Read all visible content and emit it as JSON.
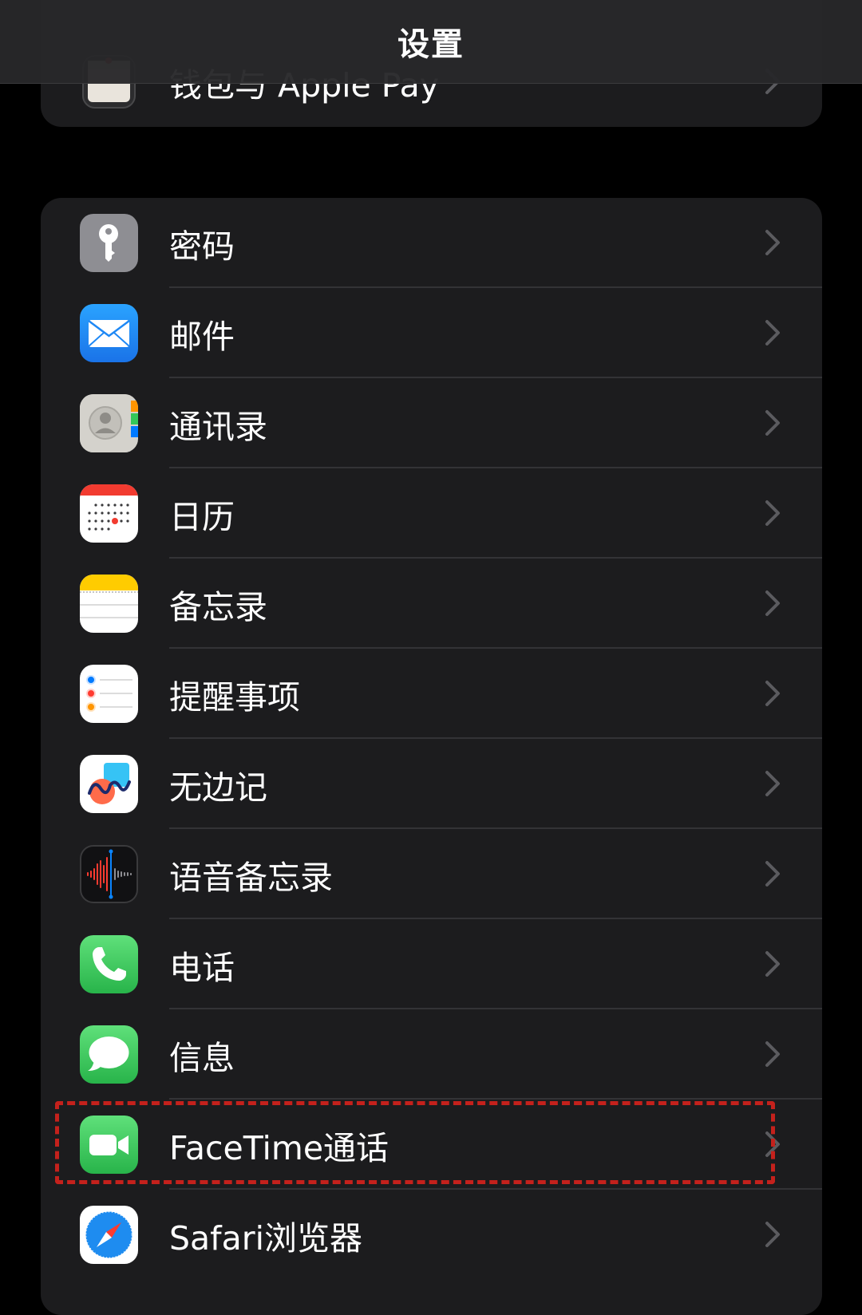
{
  "nav": {
    "title": "设置"
  },
  "top_group": {
    "item": {
      "label": "钱包与 Apple Pay",
      "icon": "wallet-icon"
    }
  },
  "main_group": {
    "items": [
      {
        "label": "密码",
        "icon": "key-icon",
        "icon_bg": "#8e8e93"
      },
      {
        "label": "邮件",
        "icon": "mail-icon",
        "icon_bg": "#1e88f5"
      },
      {
        "label": "通讯录",
        "icon": "contacts-icon",
        "icon_bg": "#d4d2cc"
      },
      {
        "label": "日历",
        "icon": "calendar-icon",
        "icon_bg": "#ffffff"
      },
      {
        "label": "备忘录",
        "icon": "notes-icon",
        "icon_bg": "#ffffff"
      },
      {
        "label": "提醒事项",
        "icon": "reminders-icon",
        "icon_bg": "#ffffff"
      },
      {
        "label": "无边记",
        "icon": "freeform-icon",
        "icon_bg": "#ffffff"
      },
      {
        "label": "语音备忘录",
        "icon": "voice-memos-icon",
        "icon_bg": "#1c1c1e"
      },
      {
        "label": "电话",
        "icon": "phone-icon",
        "icon_bg": "#30c24d"
      },
      {
        "label": "信息",
        "icon": "messages-icon",
        "icon_bg": "#30c24d"
      },
      {
        "label": "FaceTime通话",
        "icon": "facetime-icon",
        "icon_bg": "#30c24d"
      },
      {
        "label": "Safari浏览器",
        "icon": "safari-icon",
        "icon_bg": "#ffffff"
      }
    ]
  },
  "colors": {
    "highlight": "#c4211c",
    "group_bg": "#1c1c1e",
    "separator": "#333336",
    "chevron": "#5b5b5f"
  }
}
